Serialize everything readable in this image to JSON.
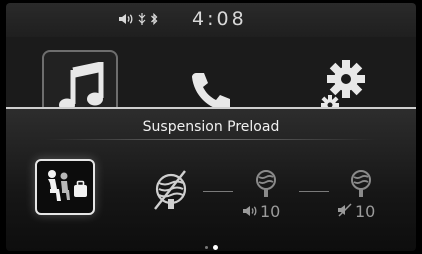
{
  "status_bar": {
    "time": "4:08",
    "icons": [
      "volume-icon",
      "gps-icon",
      "bluetooth-icon"
    ]
  },
  "home": {
    "tiles": [
      {
        "name": "music",
        "icon": "music-note-icon",
        "selected": true
      },
      {
        "name": "phone",
        "icon": "phone-icon",
        "selected": false
      },
      {
        "name": "settings",
        "icon": "gear-icon",
        "selected": false
      }
    ]
  },
  "panel": {
    "title": "Suspension Preload",
    "options": [
      {
        "icon": "rider-passenger-luggage-icon",
        "selected": true
      },
      {
        "icon": "shock-absorber-off-icon",
        "selected": false
      },
      {
        "icon": "shock-absorber-icon",
        "sub_icon": "volume-icon",
        "value": "10",
        "selected": false
      },
      {
        "icon": "shock-absorber-icon",
        "sub_icon": "mute-icon",
        "value": "10",
        "selected": false
      }
    ],
    "pagination": {
      "pages": 2,
      "current": 2
    }
  },
  "colors": {
    "background": "#000000",
    "panel_top": "#2d2d2d",
    "selected_border": "#e6e6e6",
    "inactive_text": "#9a9a9a"
  }
}
